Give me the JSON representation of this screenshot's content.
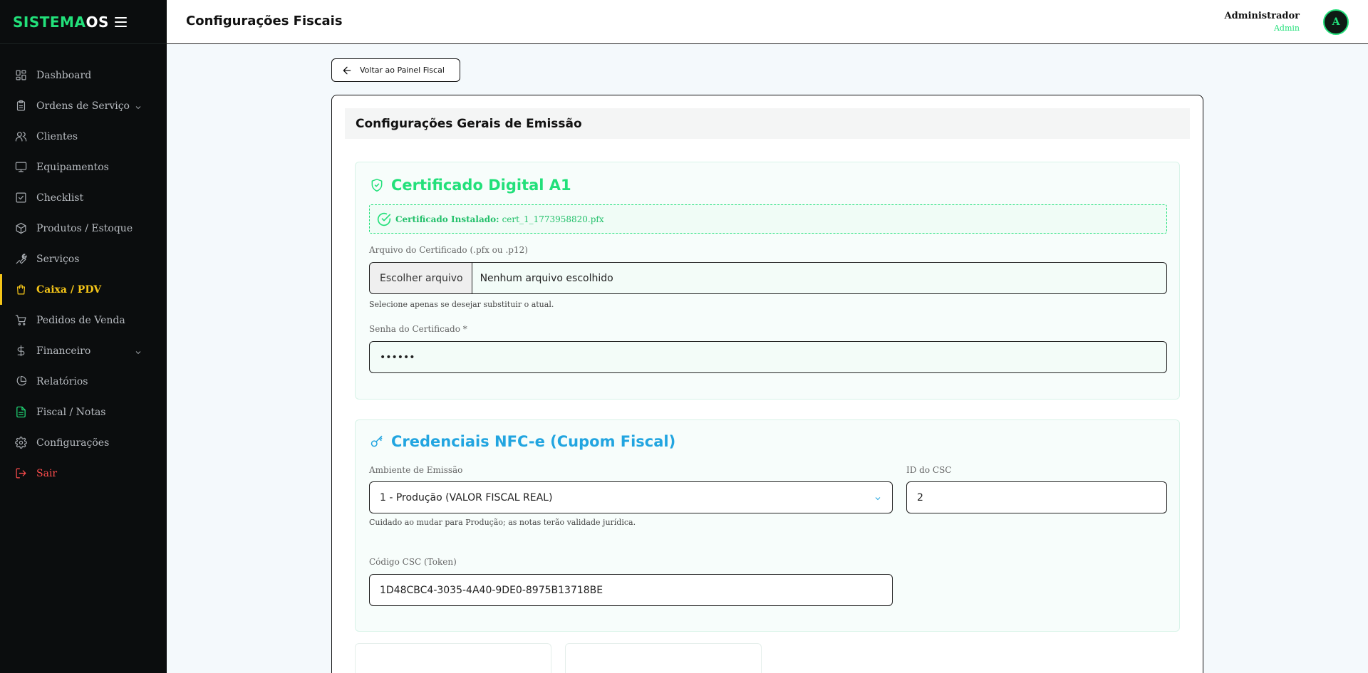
{
  "brand": {
    "part1": "SISTEMA",
    "part2": "OS"
  },
  "sidebar": {
    "items": [
      {
        "label": "Dashboard",
        "icon": "dashboard-icon"
      },
      {
        "label": "Ordens de Serviço",
        "icon": "clipboard-icon"
      },
      {
        "label": "Clientes",
        "icon": "users-icon"
      },
      {
        "label": "Equipamentos",
        "icon": "monitor-icon"
      },
      {
        "label": "Checklist",
        "icon": "checkbox-icon"
      },
      {
        "label": "Produtos / Estoque",
        "icon": "box-icon"
      },
      {
        "label": "Serviços",
        "icon": "wrench-icon"
      },
      {
        "label": "Caixa / PDV",
        "icon": "shopping-bag-icon"
      },
      {
        "label": "Pedidos de Venda",
        "icon": "cart-icon"
      },
      {
        "label": "Financeiro",
        "icon": "dollar-icon"
      },
      {
        "label": "Relatórios",
        "icon": "pie-chart-icon"
      },
      {
        "label": "Fiscal / Notas",
        "icon": "document-icon"
      },
      {
        "label": "Configurações",
        "icon": "gear-icon"
      },
      {
        "label": "Sair",
        "icon": "logout-icon"
      }
    ]
  },
  "header": {
    "title": "Configurações Fiscais",
    "user_name": "Administrador",
    "user_role": "Admin",
    "avatar_letter": "A"
  },
  "back_button": {
    "label": "Voltar ao Painel Fiscal"
  },
  "card": {
    "title": "Configurações Gerais de Emissão"
  },
  "certificate": {
    "title": "Certificado Digital A1",
    "status_label": "Certificado Instalado:",
    "status_file": "cert_1_1773958820.pfx",
    "file_label": "Arquivo do Certificado (.pfx ou .p12)",
    "file_button": "Escolher arquivo",
    "file_value": "Nenhum arquivo escolhido",
    "file_hint": "Selecione apenas se desejar substituir o atual.",
    "password_label": "Senha do Certificado *",
    "password_value": "••••••"
  },
  "nfce": {
    "title": "Credenciais NFC-e (Cupom Fiscal)",
    "env_label": "Ambiente de Emissão",
    "env_value": "1 - Produção (VALOR FISCAL REAL)",
    "env_hint": "Cuidado ao mudar para Produção; as notas terão validade jurídica.",
    "csc_id_label": "ID do CSC",
    "csc_id_value": "2",
    "csc_token_label": "Código CSC (Token)",
    "csc_token_value": "1D48CBC4-3035-4A40-9DE0-8975B13718BE"
  },
  "colors": {
    "accent_green": "#22e07a",
    "accent_blue": "#22a5e0",
    "active_yellow": "#f5c518",
    "danger": "#ff4d4d",
    "sidebar_bg": "#0b0d0e"
  }
}
